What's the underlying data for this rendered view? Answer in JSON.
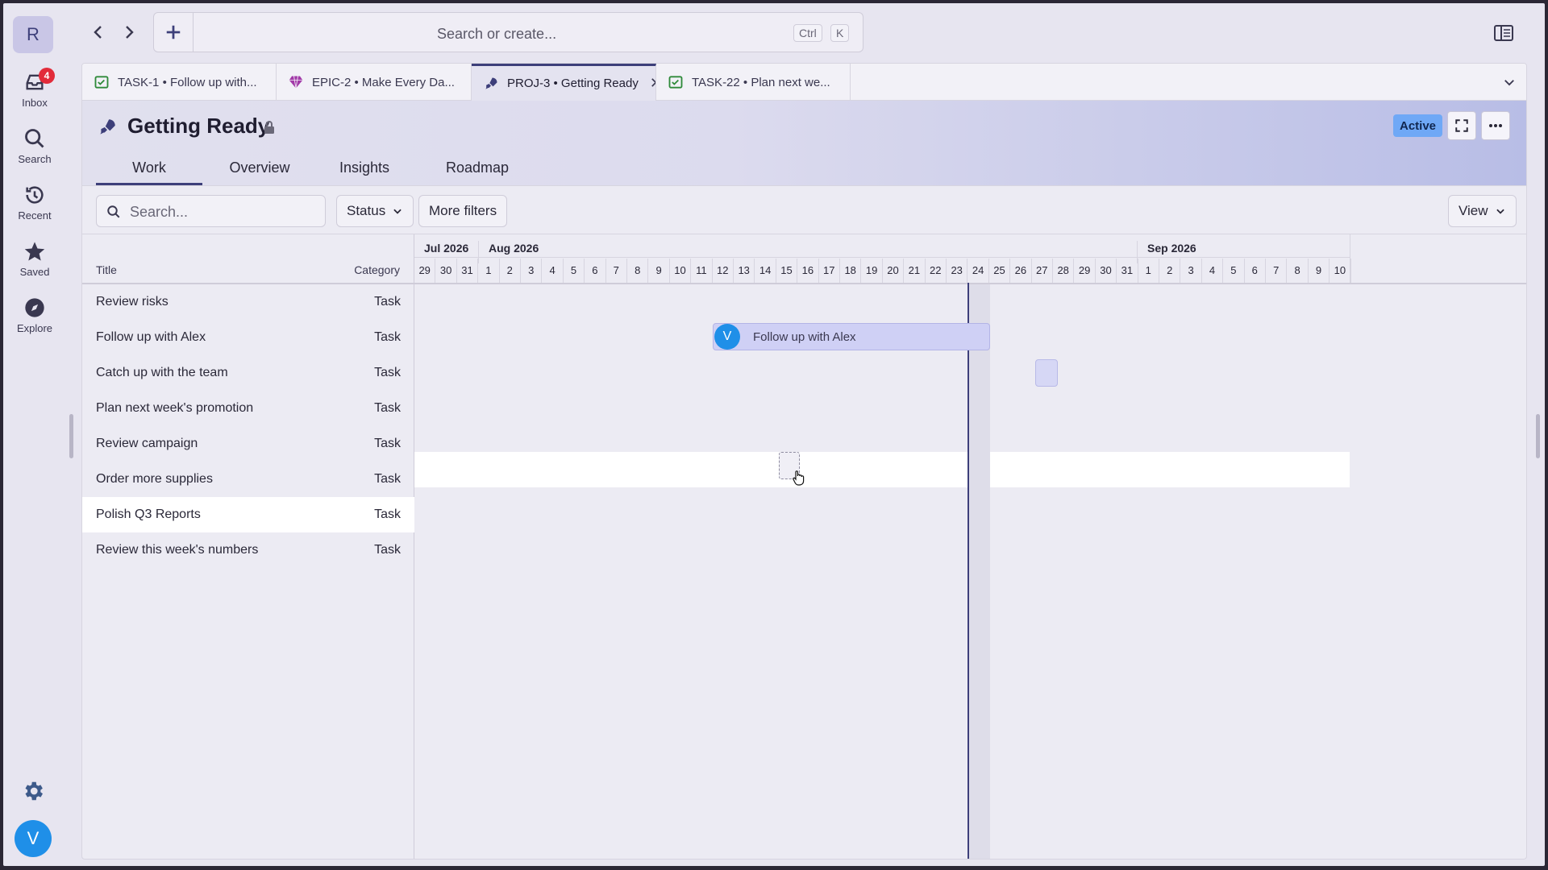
{
  "rail": {
    "workspace_initial": "R",
    "items": [
      {
        "label": "Inbox",
        "icon": "inbox-icon",
        "badge": "4"
      },
      {
        "label": "Search",
        "icon": "search-icon"
      },
      {
        "label": "Recent",
        "icon": "history-icon"
      },
      {
        "label": "Saved",
        "icon": "star-icon"
      },
      {
        "label": "Explore",
        "icon": "compass-icon"
      }
    ],
    "user_initial": "V"
  },
  "topbar": {
    "search_placeholder": "Search or create...",
    "shortcut_keys": [
      "Ctrl",
      "K"
    ]
  },
  "tabs": [
    {
      "label": "TASK-1 • Follow up with...",
      "icon": "task-check-icon",
      "active": false
    },
    {
      "label": "EPIC-2 • Make Every Da...",
      "icon": "gem-icon",
      "active": false
    },
    {
      "label": "PROJ-3 • Getting Ready",
      "icon": "rocket-icon",
      "active": true
    },
    {
      "label": "TASK-22 • Plan next we...",
      "icon": "task-check-icon",
      "active": false
    }
  ],
  "project": {
    "title": "Getting Ready",
    "status": "Active",
    "subtabs": [
      "Work",
      "Overview",
      "Insights",
      "Roadmap"
    ],
    "active_subtab": "Work"
  },
  "toolbar": {
    "search_placeholder": "Search...",
    "status_label": "Status",
    "more_filters_label": "More filters",
    "view_label": "View"
  },
  "list": {
    "col_title": "Title",
    "col_category": "Category",
    "rows": [
      {
        "title": "Review risks",
        "category": "Task"
      },
      {
        "title": "Follow up with Alex",
        "category": "Task"
      },
      {
        "title": "Catch up with the team",
        "category": "Task"
      },
      {
        "title": "Plan next week's promotion",
        "category": "Task"
      },
      {
        "title": "Review campaign",
        "category": "Task"
      },
      {
        "title": "Order more supplies",
        "category": "Task"
      },
      {
        "title": "Polish Q3 Reports",
        "category": "Task"
      },
      {
        "title": "Review this week's numbers",
        "category": "Task"
      }
    ],
    "highlighted_row": 6
  },
  "timeline": {
    "months": [
      "Jul 2026",
      "Aug 2026",
      "Sep 2026"
    ],
    "days": [
      "29",
      "30",
      "31",
      "1",
      "2",
      "3",
      "4",
      "5",
      "6",
      "7",
      "8",
      "9",
      "10",
      "11",
      "12",
      "13",
      "14",
      "15",
      "16",
      "17",
      "18",
      "19",
      "20",
      "21",
      "22",
      "23",
      "24",
      "25",
      "26",
      "27",
      "28",
      "29",
      "30",
      "31",
      "1",
      "2",
      "3",
      "4",
      "5",
      "6",
      "7",
      "8",
      "9",
      "10"
    ],
    "bar": {
      "label": "Follow up with Alex",
      "assignee_initial": "V"
    }
  }
}
